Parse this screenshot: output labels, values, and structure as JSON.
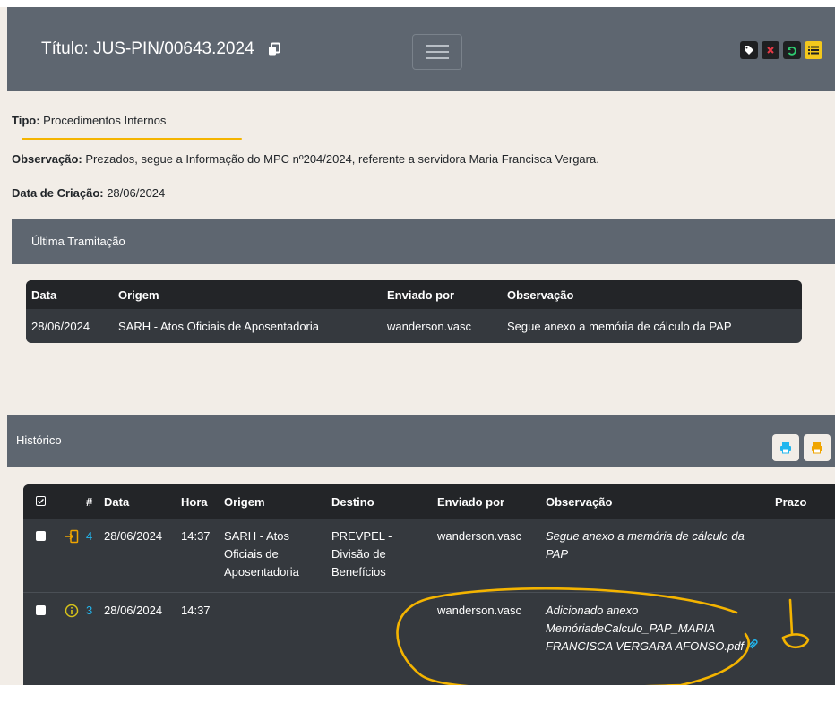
{
  "header": {
    "title": "Título: JUS-PIN/00643.2024",
    "action_colors": [
      "#ffffff",
      "#e63946",
      "#2ecc71",
      "#f3c81c"
    ]
  },
  "info": {
    "tipo_label": "Tipo:",
    "tipo_value": " Procedimentos Internos",
    "obs_label": "Observação:",
    "obs_value": " Prezados, segue a Informação do MPC nº204/2024, referente a servidora Maria Francisca Vergara.",
    "data_label": "Data de Criação:",
    "data_value": " 28/06/2024"
  },
  "ultima": {
    "title": "Última Tramitação",
    "headers": {
      "data": "Data",
      "origem": "Origem",
      "enviado": "Enviado por",
      "obs": "Observação"
    },
    "row": {
      "data": "28/06/2024",
      "origem": "SARH - Atos Oficiais de Aposentadoria",
      "enviado": "wanderson.vasc",
      "obs": "Segue anexo a memória de cálculo da PAP"
    }
  },
  "historico": {
    "title": "Histórico",
    "headers": {
      "num": "#",
      "data": "Data",
      "hora": "Hora",
      "origem": "Origem",
      "destino": "Destino",
      "enviado": "Enviado por",
      "obs": "Observação",
      "prazo": "Prazo"
    },
    "rows": [
      {
        "icon": "enter-arrow-icon",
        "num": "4",
        "data": "28/06/2024",
        "hora": "14:37",
        "origem": "SARH - Atos Oficiais de Aposentadoria",
        "destino": "PREVPEL - Divisão de Benefícios",
        "enviado": "wanderson.vasc",
        "obs": "Segue anexo a memória de cálculo da PAP"
      },
      {
        "icon": "info-circle-icon",
        "num": "3",
        "data": "28/06/2024",
        "hora": "14:37",
        "origem": "",
        "destino": "",
        "enviado": "wanderson.vasc",
        "obs": "Adicionado anexo MemóriadeCalculo_PAP_MARIA FRANCISCA VERGARA AFONSO.pdf"
      }
    ]
  }
}
